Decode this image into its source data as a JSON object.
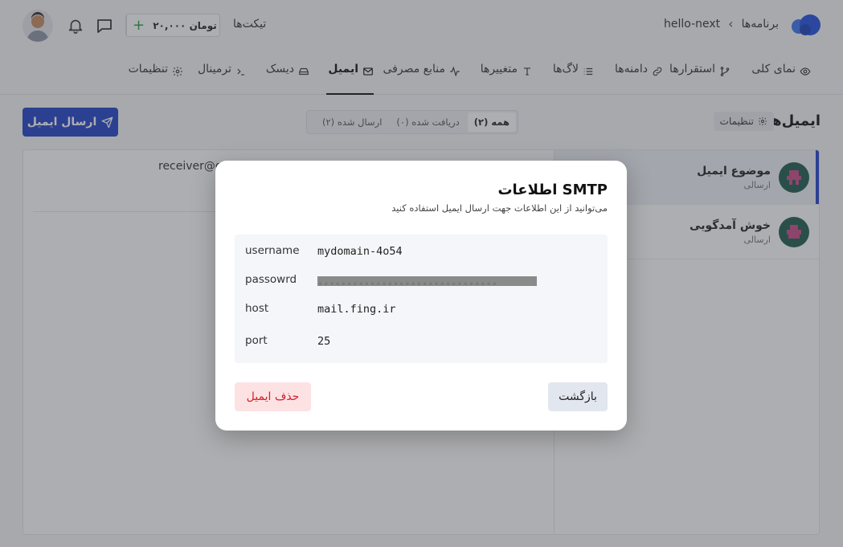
{
  "header": {
    "breadcrumb": {
      "root": "برنامه‌ها",
      "current": "hello-next"
    },
    "tickets_label": "تیکت‌ها",
    "balance": "۲۰,۰۰۰ تومان"
  },
  "tabs": [
    {
      "label": "نمای کلی",
      "icon": "eye-icon"
    },
    {
      "label": "استقرارها",
      "icon": "branch-icon"
    },
    {
      "label": "دامنه‌ها",
      "icon": "link-icon"
    },
    {
      "label": "لاگ‌ها",
      "icon": "list-icon"
    },
    {
      "label": "متغییرها",
      "icon": "text-icon"
    },
    {
      "label": "منابع مصرفی",
      "icon": "activity-icon"
    },
    {
      "label": "ایمیل",
      "icon": "mail-icon",
      "active": true
    },
    {
      "label": "دیسک",
      "icon": "disk-icon"
    },
    {
      "label": "ترمینال",
      "icon": "terminal-icon"
    },
    {
      "label": "تنظیمات",
      "icon": "gear-icon"
    }
  ],
  "page": {
    "title": "ایمیل‌ها",
    "settings_chip": "تنظیمات",
    "filters": [
      "همه (۲)",
      "دریافت شده (۰)",
      "ارسال شده (۲)"
    ],
    "send_button": "ارسال ایمیل"
  },
  "emails": [
    {
      "subject": "موضوع ایمیل",
      "status": "ارسالی"
    },
    {
      "subject": "خوش آمدگویی",
      "status": "ارسالی"
    }
  ],
  "detail": {
    "to": "receiver@gm"
  },
  "modal": {
    "title": "اطلاعات SMTP",
    "subtitle": "می‌توانید از این اطلاعات جهت ارسال ایمیل استفاده کنید",
    "rows": {
      "username_key": "username",
      "username_val": "mydomain-4o54",
      "password_key": "passowrd",
      "host_key": "host",
      "host_val": "mail.fing.ir",
      "port_key": "port",
      "port_val": "25"
    },
    "back_button": "بازگشت",
    "delete_button": "حذف ایمیل"
  },
  "colors": {
    "primary": "#2243c9",
    "danger": "#d21d2b"
  }
}
